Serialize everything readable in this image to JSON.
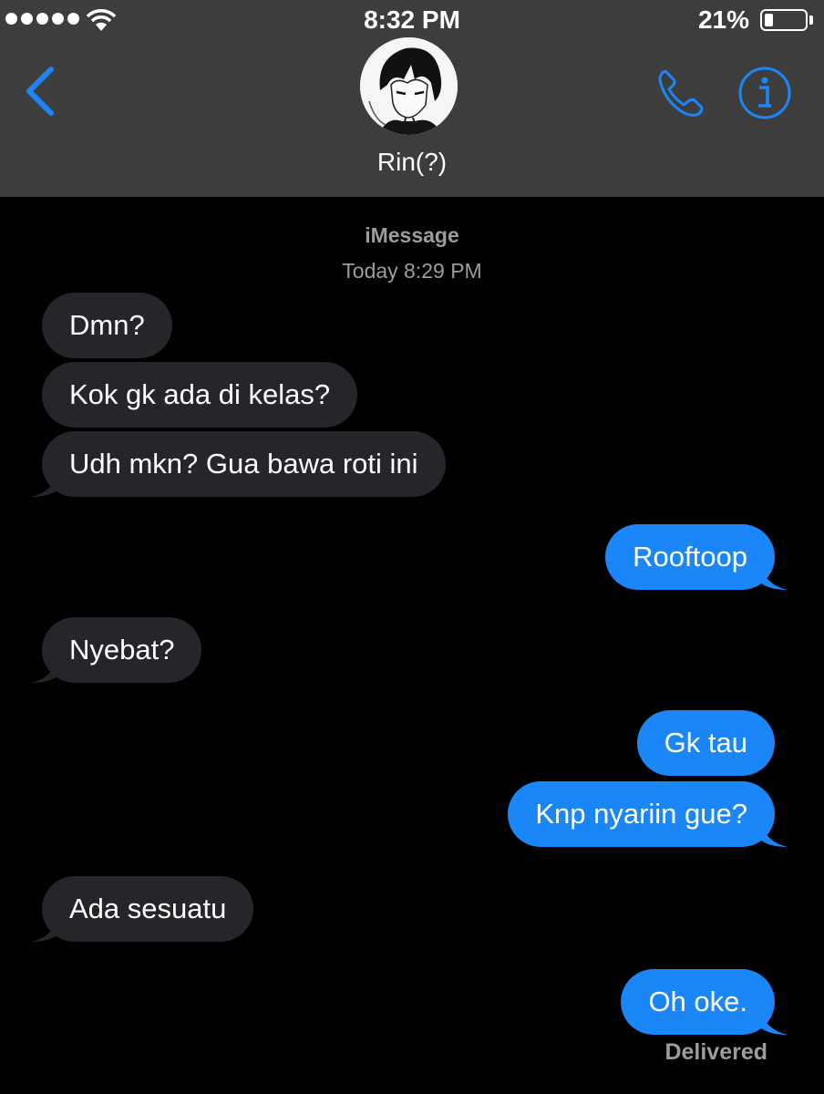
{
  "status_bar": {
    "time": "8:32 PM",
    "battery_percent_label": "21%",
    "battery_level": 0.21,
    "signal_dots": 5
  },
  "header": {
    "contact_name": "Rin(?)",
    "accent_color": "#1b86f8"
  },
  "thread": {
    "service": "iMessage",
    "timestamp_day": "Today",
    "timestamp_time": "8:29 PM"
  },
  "messages": [
    {
      "from": "them",
      "text": "Dmn?"
    },
    {
      "from": "them",
      "text": "Kok gk ada di kelas?"
    },
    {
      "from": "them",
      "text": "Udh mkn? Gua bawa roti ini"
    },
    {
      "from": "me",
      "text": "Rooftoop"
    },
    {
      "from": "them",
      "text": "Nyebat?"
    },
    {
      "from": "me",
      "text": "Gk tau"
    },
    {
      "from": "me",
      "text": "Knp nyariin gue?"
    },
    {
      "from": "them",
      "text": "Ada sesuatu"
    },
    {
      "from": "me",
      "text": "Oh oke."
    }
  ],
  "delivery_status": "Delivered",
  "colors": {
    "incoming_bubble": "#262529",
    "outgoing_bubble": "#1b86f8",
    "header_bg": "#3d3d3e",
    "meta_text": "#9c9ca0"
  }
}
